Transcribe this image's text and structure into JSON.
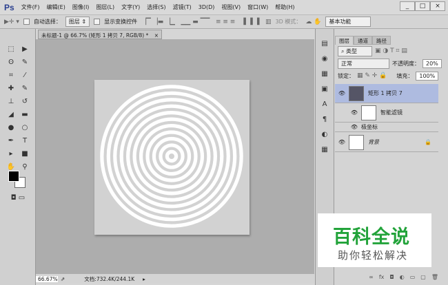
{
  "app": {
    "logo": "Ps"
  },
  "menu": [
    "文件(F)",
    "编辑(E)",
    "图像(I)",
    "图层(L)",
    "文字(Y)",
    "选择(S)",
    "滤镜(T)",
    "3D(D)",
    "视图(V)",
    "窗口(W)",
    "帮助(H)"
  ],
  "window_buttons": [
    "_",
    "□",
    "×"
  ],
  "options": {
    "auto_select": "自动选择：",
    "auto_select_target": "图层",
    "show_transform": "显示变换控件",
    "mode_3d": "3D 模式：",
    "workspace": "基本功能"
  },
  "document": {
    "tab_title": "未标题-1 @ 66.7% (矩形 1 拷贝 7, RGB/8) *",
    "close": "×",
    "ring_count": 11
  },
  "status": {
    "zoom": "66.67%",
    "doc_info": "文档:732.4K/244.1K"
  },
  "layers_panel": {
    "tabs": [
      "图层",
      "通道",
      "路径"
    ],
    "filter_kind": "类型",
    "blend_mode": "正常",
    "opacity_label": "不透明度：",
    "opacity": "20%",
    "lock_label": "锁定：",
    "fill_label": "填充：",
    "fill": "100%",
    "layers": [
      {
        "name": "矩形 1 拷贝 7"
      },
      {
        "name": "智能滤镜"
      },
      {
        "name": "极坐标"
      },
      {
        "name": "背景"
      }
    ]
  },
  "watermark": {
    "title": "百科全说",
    "subtitle": "助你轻松解决"
  }
}
